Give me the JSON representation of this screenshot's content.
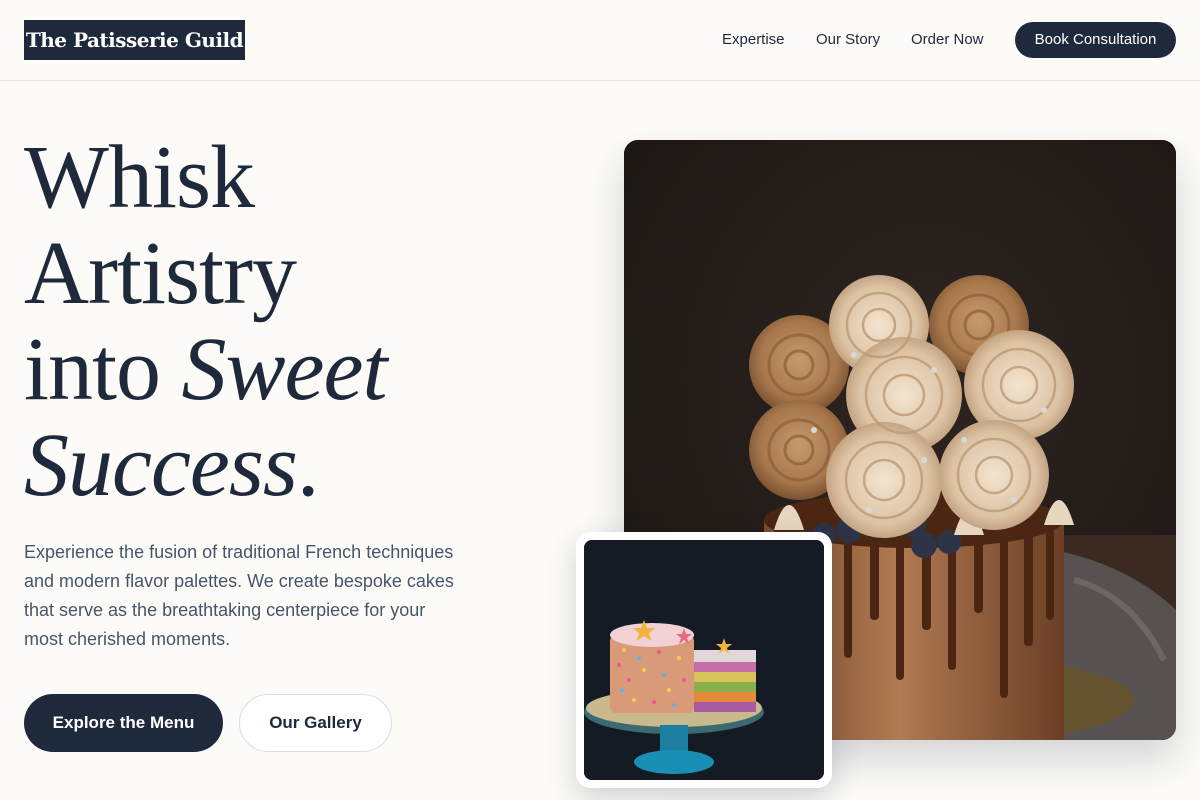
{
  "header": {
    "logo": "The Patisserie Guild",
    "nav": [
      "Expertise",
      "Our Story",
      "Order Now"
    ],
    "cta": "Book Consultation"
  },
  "hero": {
    "headline_1": "Whisk",
    "headline_2": "Artistry",
    "headline_3a": "into ",
    "headline_3b": "Sweet",
    "headline_4a": "Success",
    "headline_4b": ".",
    "lead": "Experience the fusion of traditional French techniques and modern flavor palettes. We create bespoke cakes that serve as the breathtaking centerpiece for your most cherished moments.",
    "primary_button": "Explore the Menu",
    "secondary_button": "Our Gallery"
  },
  "colors": {
    "brand_dark": "#1e293b",
    "background": "#fcfbf8",
    "body_text": "#475569"
  },
  "images": {
    "main": "chocolate-drip-cake-with-meringue-swirls",
    "thumb": "rainbow-sprinkle-layer-cake-on-stand"
  }
}
